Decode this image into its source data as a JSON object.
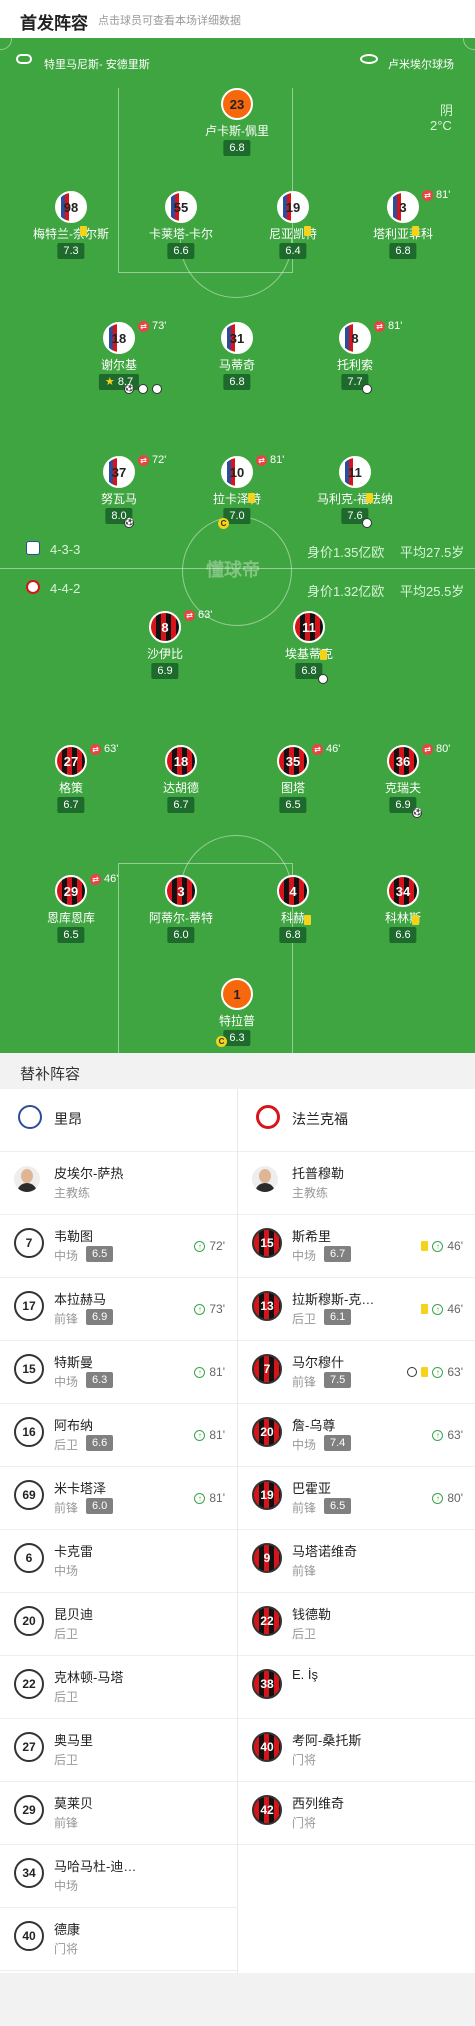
{
  "header": {
    "title": "首发阵容",
    "hint": "点击球员可查看本场详细数据"
  },
  "match": {
    "referee": "特里马尼斯- 安德里斯",
    "stadium": "卢米埃尔球场",
    "weather": "阴",
    "temperature": "2°C",
    "watermark": "懂球帝",
    "home": {
      "formation": "4-3-3",
      "value": "身价1.35亿欧",
      "avg_age": "平均27.5岁"
    },
    "away": {
      "formation": "4-4-2",
      "value": "身价1.32亿欧",
      "avg_age": "平均25.5岁"
    }
  },
  "home_players": [
    {
      "num": "23",
      "name": "卢卡斯-佩里",
      "rating": "6.8",
      "gk": true
    },
    {
      "num": "98",
      "name": "梅特兰-奈尔斯",
      "rating": "7.3"
    },
    {
      "num": "55",
      "name": "卡莱塔-卡尔",
      "rating": "6.6"
    },
    {
      "num": "19",
      "name": "尼亚凯特",
      "rating": "6.4"
    },
    {
      "num": "3",
      "name": "塔利亚菲科",
      "rating": "6.8",
      "sub_min": "81'"
    },
    {
      "num": "18",
      "name": "谢尔基",
      "rating": "8.7",
      "sub_min": "73'",
      "star": true
    },
    {
      "num": "31",
      "name": "马蒂奇",
      "rating": "6.8"
    },
    {
      "num": "8",
      "name": "托利索",
      "rating": "7.7",
      "sub_min": "81'"
    },
    {
      "num": "37",
      "name": "努瓦马",
      "rating": "8.0",
      "sub_min": "72'"
    },
    {
      "num": "10",
      "name": "拉卡泽特",
      "rating": "7.0",
      "sub_min": "81'"
    },
    {
      "num": "11",
      "name": "马利克-福法纳",
      "rating": "7.6"
    }
  ],
  "away_players": [
    {
      "num": "8",
      "name": "沙伊比",
      "rating": "6.9",
      "sub_min": "63'"
    },
    {
      "num": "11",
      "name": "埃基蒂克",
      "rating": "6.8"
    },
    {
      "num": "27",
      "name": "格策",
      "rating": "6.7",
      "sub_min": "63'"
    },
    {
      "num": "18",
      "name": "达胡德",
      "rating": "6.7"
    },
    {
      "num": "35",
      "name": "图塔",
      "rating": "6.5",
      "sub_min": "46'"
    },
    {
      "num": "36",
      "name": "克瑞夫",
      "rating": "6.9",
      "sub_min": "80'"
    },
    {
      "num": "29",
      "name": "恩库恩库",
      "rating": "6.5",
      "sub_min": "46'"
    },
    {
      "num": "3",
      "name": "阿蒂尔-蒂特",
      "rating": "6.0"
    },
    {
      "num": "4",
      "name": "科赫",
      "rating": "6.8"
    },
    {
      "num": "34",
      "name": "科林斯",
      "rating": "6.6"
    },
    {
      "num": "1",
      "name": "特拉普",
      "rating": "6.3",
      "gk": true
    }
  ],
  "subs": {
    "title": "替补阵容",
    "home_team": "里昂",
    "away_team": "法兰克福",
    "home_coach": {
      "name": "皮埃尔-萨热",
      "role": "主教练"
    },
    "away_coach": {
      "name": "托普穆勒",
      "role": "主教练"
    },
    "home": [
      {
        "num": "7",
        "name": "韦勒图",
        "pos": "中场",
        "rating": "6.5",
        "minute": "72'"
      },
      {
        "num": "17",
        "name": "本拉赫马",
        "pos": "前锋",
        "rating": "6.9",
        "minute": "73'"
      },
      {
        "num": "15",
        "name": "特斯曼",
        "pos": "中场",
        "rating": "6.3",
        "minute": "81'"
      },
      {
        "num": "16",
        "name": "阿布纳",
        "pos": "后卫",
        "rating": "6.6",
        "minute": "81'"
      },
      {
        "num": "69",
        "name": "米卡塔泽",
        "pos": "前锋",
        "rating": "6.0",
        "minute": "81'"
      },
      {
        "num": "6",
        "name": "卡克雷",
        "pos": "中场"
      },
      {
        "num": "20",
        "name": "昆贝迪",
        "pos": "后卫"
      },
      {
        "num": "22",
        "name": "克林顿-马塔",
        "pos": "后卫"
      },
      {
        "num": "27",
        "name": "奥马里",
        "pos": "后卫"
      },
      {
        "num": "29",
        "name": "莫莱贝",
        "pos": "前锋"
      },
      {
        "num": "34",
        "name": "马哈马杜-迪…",
        "pos": "中场"
      },
      {
        "num": "40",
        "name": "德康",
        "pos": "门将"
      }
    ],
    "away": [
      {
        "num": "15",
        "name": "斯希里",
        "pos": "中场",
        "rating": "6.7",
        "minute": "46'",
        "yellow": true
      },
      {
        "num": "13",
        "name": "拉斯穆斯-克…",
        "pos": "后卫",
        "rating": "6.1",
        "minute": "46'",
        "yellow": true
      },
      {
        "num": "7",
        "name": "马尔穆什",
        "pos": "前锋",
        "rating": "7.5",
        "minute": "63'",
        "goal": true,
        "yellow": true
      },
      {
        "num": "20",
        "name": "詹-乌尊",
        "pos": "中场",
        "rating": "7.4",
        "minute": "63'"
      },
      {
        "num": "19",
        "name": "巴霍亚",
        "pos": "前锋",
        "rating": "6.5",
        "minute": "80'"
      },
      {
        "num": "9",
        "name": "马塔诺维奇",
        "pos": "前锋"
      },
      {
        "num": "22",
        "name": "钱德勒",
        "pos": "后卫"
      },
      {
        "num": "38",
        "name": "E. İş",
        "pos": ""
      },
      {
        "num": "40",
        "name": "考阿-桑托斯",
        "pos": "门将"
      },
      {
        "num": "42",
        "name": "西列维奇",
        "pos": "门将"
      }
    ]
  }
}
